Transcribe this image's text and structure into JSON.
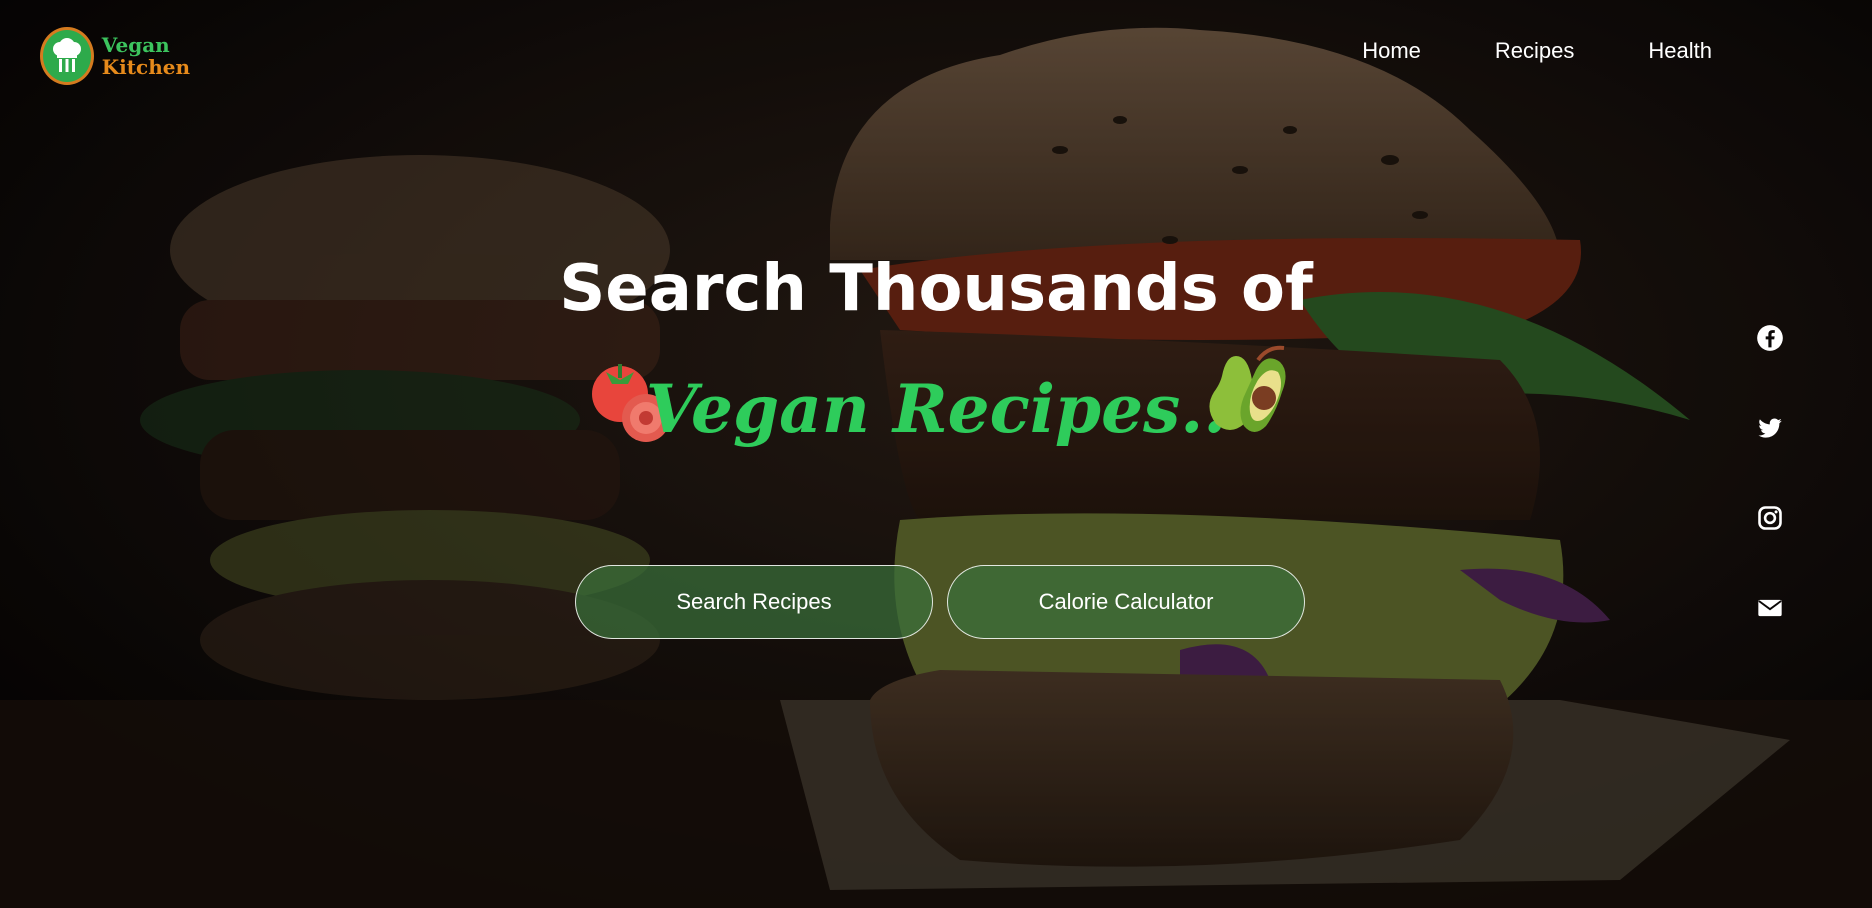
{
  "logo": {
    "line1": "Vegan",
    "line2": "Kitchen"
  },
  "nav": {
    "items": [
      {
        "label": "Home"
      },
      {
        "label": "Recipes"
      },
      {
        "label": "Health"
      }
    ]
  },
  "hero": {
    "headline_line1": "Search Thousands of",
    "headline_line2": "Vegan Recipes..",
    "buttons": {
      "search": "Search Recipes",
      "calculator": "Calorie Calculator"
    }
  },
  "social": {
    "icons": [
      "facebook-icon",
      "twitter-icon",
      "instagram-icon",
      "mail-icon"
    ]
  },
  "colors": {
    "accent_green": "#2ecc5b",
    "logo_orange": "#e68a1b",
    "button_bg": "#3a703a"
  }
}
